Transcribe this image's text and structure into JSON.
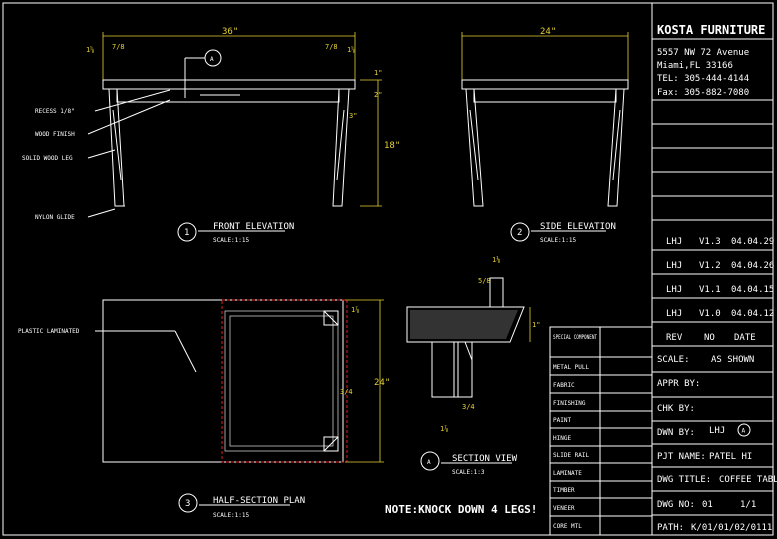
{
  "company": {
    "name": "KOSTA FURNITURE",
    "address1": "5557 NW 72 Avenue",
    "address2": "Miami,FL   33166",
    "tel": "TEL: 305-444-4144",
    "fax": "Fax: 305-882-7080"
  },
  "revisions": [
    {
      "by": "LHJ",
      "ver": "V1.3",
      "date": "04.04.29"
    },
    {
      "by": "LHJ",
      "ver": "V1.2",
      "date": "04.04.26"
    },
    {
      "by": "LHJ",
      "ver": "V1.1",
      "date": "04.04.15"
    },
    {
      "by": "LHJ",
      "ver": "V1.0",
      "date": "04.04.12"
    }
  ],
  "rev_header": {
    "rev": "REV",
    "no": "NO",
    "date": "DATE"
  },
  "title_block": {
    "scale_label": "SCALE:",
    "scale_value": "AS SHOWN",
    "appr_label": "APPR BY:",
    "chk_label": "CHK BY:",
    "dwn_label": "DWN BY:",
    "dwn_value": "LHJ",
    "dwn_mark": "A",
    "pjt_label": "PJT NAME:",
    "pjt_value": "PATEL HI",
    "title_label": "DWG TITLE:",
    "title_value": "COFFEE TABLE",
    "no_label": "DWG NO:",
    "no_value": "01",
    "sheet": "1/1",
    "path_label": "PATH:",
    "path_value": "K/01/01/02/0111"
  },
  "materials": [
    "SPECIAL COMPONENT",
    "METAL PULL",
    "FABRIC",
    "FINISHING",
    "PAINT",
    "HINGE",
    "SLIDE RAIL",
    "LAMINATE",
    "TIMBER",
    "VENEER",
    "CORE MTL"
  ],
  "front": {
    "title": "FRONT ELEVATION",
    "scale": "SCALE:1:15",
    "num": "1",
    "width": "36\"",
    "height": "18\"",
    "h1": "1\"",
    "h2": "2\"",
    "h3": "3\"",
    "labels": [
      "RECESS 1/8\"",
      "WOOD FINISH",
      "SOLID WOOD LEG",
      "NYLON GLIDE"
    ],
    "callout": "A"
  },
  "side": {
    "title": "SIDE ELEVATION",
    "scale": "SCALE:1:15",
    "num": "2",
    "width": "24\""
  },
  "plan": {
    "title": "HALF-SECTION PLAN",
    "scale": "SCALE:1:15",
    "num": "3",
    "depth": "24\"",
    "label": "PLASTIC LAMINATED"
  },
  "section": {
    "title": "SECTION VIEW",
    "scale": "SCALE:1:3",
    "mark": "A",
    "thick": "1\""
  },
  "note": "NOTE:KNOCK DOWN 4 LEGS!"
}
